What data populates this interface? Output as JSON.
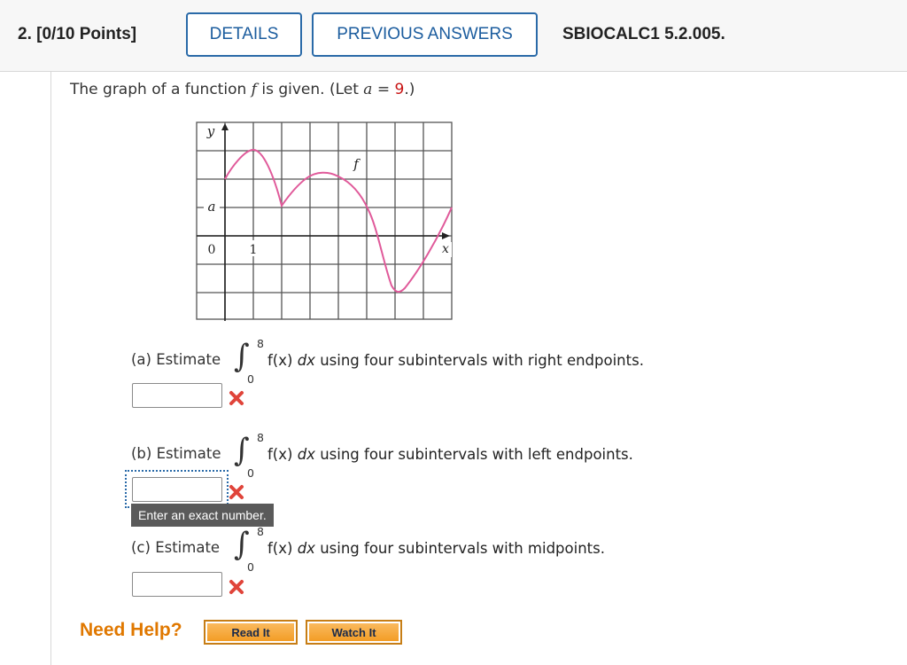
{
  "header": {
    "question_number": "2.",
    "points": "[0/10 Points]",
    "details_label": "DETAILS",
    "previous_answers_label": "PREVIOUS ANSWERS",
    "question_code": "SBIOCALC1 5.2.005."
  },
  "prompt": {
    "text_before": "The graph of a function ",
    "func": "f",
    "text_mid": " is given. (Let ",
    "var": "a",
    "equals": " = ",
    "value": "9",
    "text_end": ".)"
  },
  "graph": {
    "y_axis_label": "y",
    "x_axis_label": "x",
    "curve_label": "f",
    "a_label": "a",
    "origin_label": "0",
    "one_label": "1",
    "curve_color": "#e05a9a"
  },
  "parts": [
    {
      "label": "(a) Estimate",
      "upper": "8",
      "lower": "0",
      "integrand": "f(x)",
      "dx": "dx",
      "suffix": " using four subintervals with right endpoints."
    },
    {
      "label": "(b) Estimate",
      "upper": "8",
      "lower": "0",
      "integrand": "f(x)",
      "dx": "dx",
      "suffix": " using four subintervals with left endpoints."
    },
    {
      "label": "(c) Estimate",
      "upper": "8",
      "lower": "0",
      "integrand": "f(x)",
      "dx": "dx",
      "suffix": " using four subintervals with midpoints."
    }
  ],
  "tooltip": "Enter an exact number.",
  "help": {
    "label": "Need Help?",
    "read_it": "Read It",
    "watch_it": "Watch It"
  },
  "colors": {
    "accent": "#1b5c9e",
    "incorrect": "#e0443a",
    "help_orange": "#e07800"
  }
}
